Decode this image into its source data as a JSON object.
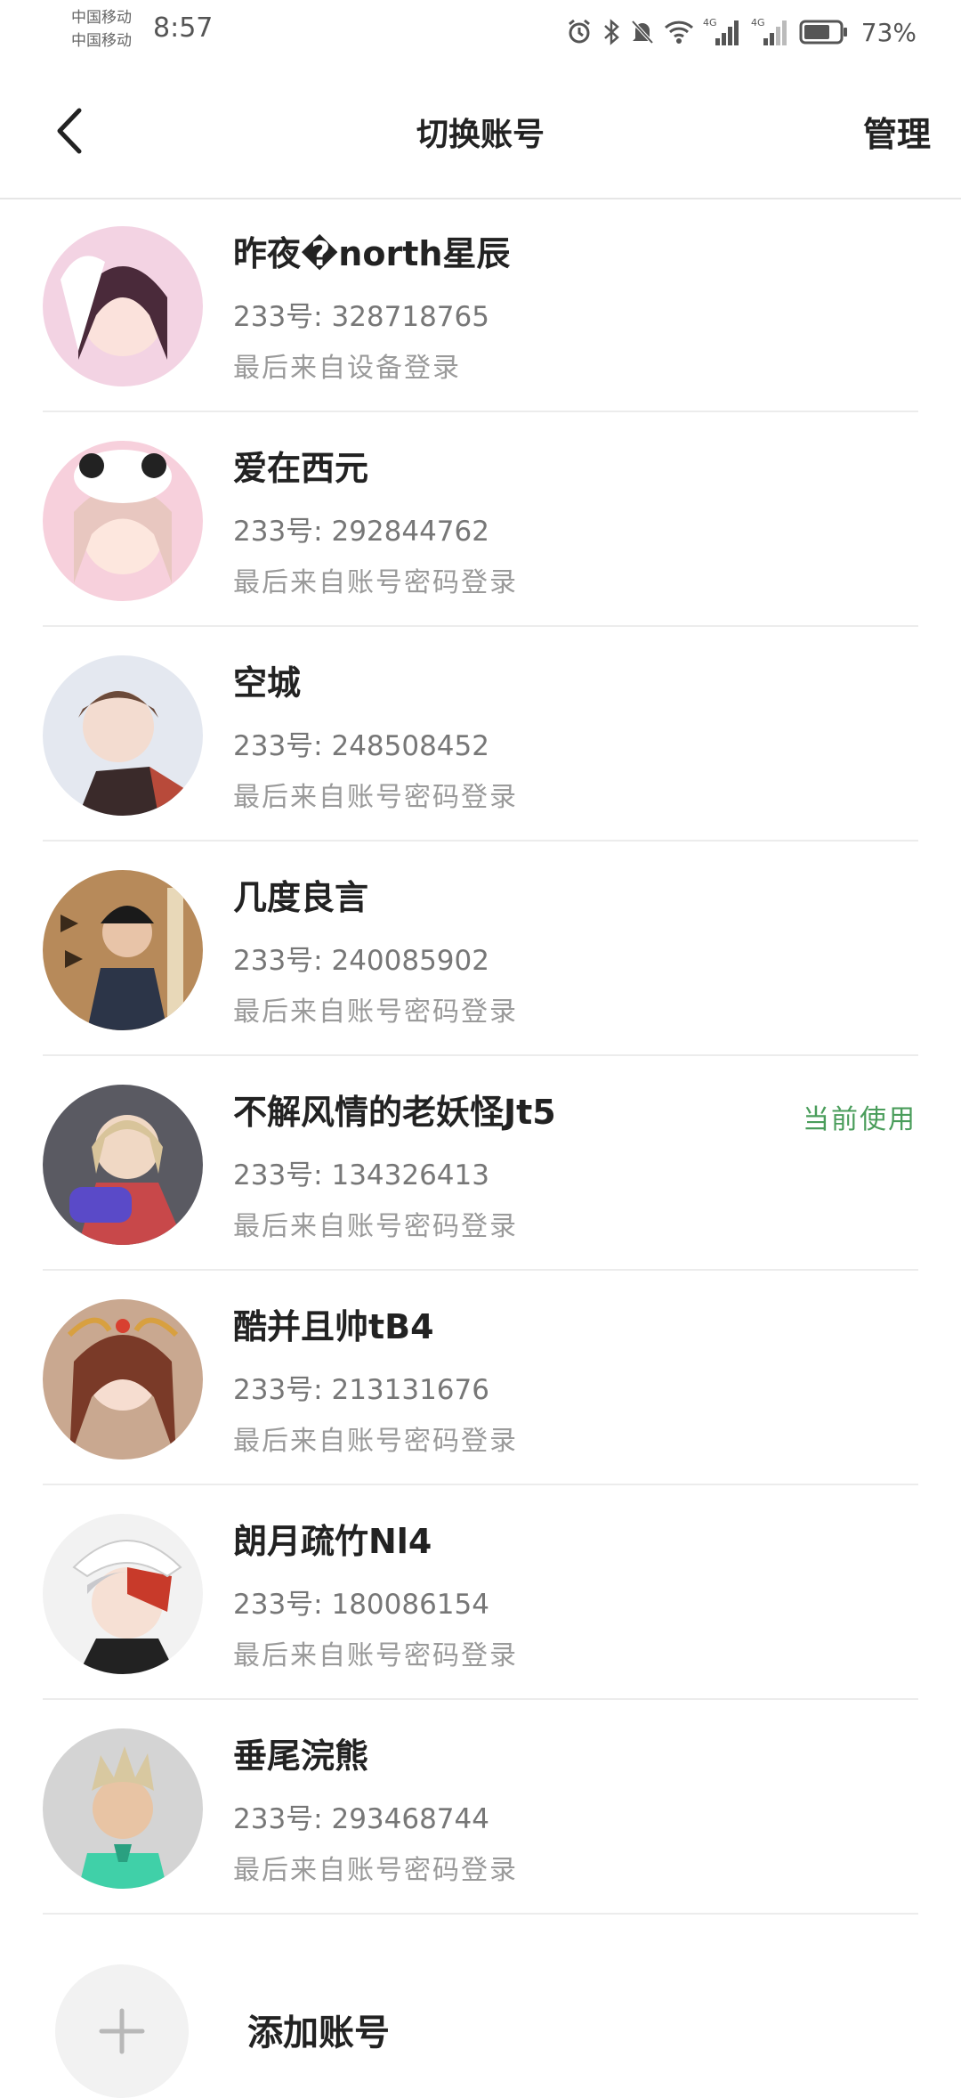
{
  "status_bar": {
    "carrier_1": "中国移动",
    "carrier_2": "中国移动",
    "time": "8:57",
    "battery": "73%",
    "network_1": "4G",
    "network_2": "4G"
  },
  "header": {
    "title": "切换账号",
    "manage_label": "管理"
  },
  "accounts": [
    {
      "name": "昨夜�north星辰",
      "id": "233号: 328718765",
      "login": "最后来自设备登录",
      "current": ""
    },
    {
      "name": "爱在西元",
      "id": "233号: 292844762",
      "login": "最后来自账号密码登录",
      "current": ""
    },
    {
      "name": "空城",
      "id": "233号: 248508452",
      "login": "最后来自账号密码登录",
      "current": ""
    },
    {
      "name": "几度良言",
      "id": "233号: 240085902",
      "login": "最后来自账号密码登录",
      "current": ""
    },
    {
      "name": "不解风情的老妖怪Jt5",
      "id": "233号: 134326413",
      "login": "最后来自账号密码登录",
      "current": "当前使用"
    },
    {
      "name": "酷并且帅tB4",
      "id": "233号: 213131676",
      "login": "最后来自账号密码登录",
      "current": ""
    },
    {
      "name": "朗月疏竹Nl4",
      "id": "233号: 180086154",
      "login": "最后来自账号密码登录",
      "current": ""
    },
    {
      "name": "垂尾浣熊",
      "id": "233号: 293468744",
      "login": "最后来自账号密码登录",
      "current": ""
    }
  ],
  "add_account": {
    "label": "添加账号"
  },
  "colors": {
    "current_badge": "#4a9d5b",
    "divider": "#ececec",
    "secondary_text": "#777777",
    "hint_text": "#9a9a9a"
  }
}
